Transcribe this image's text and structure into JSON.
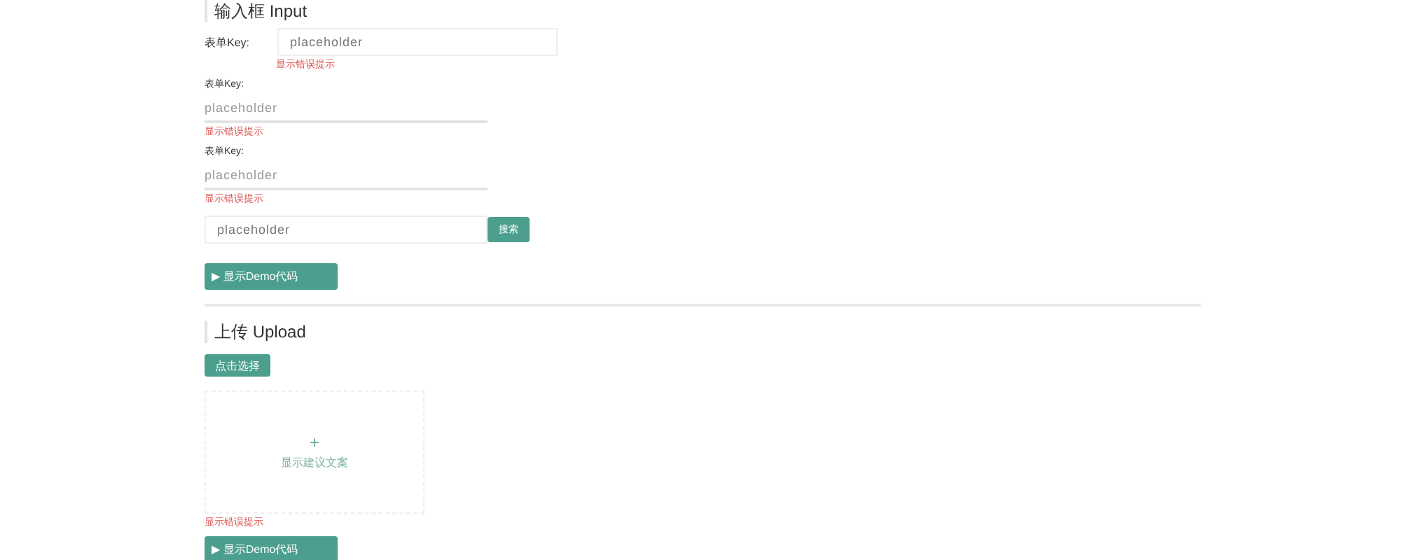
{
  "input_section": {
    "title": "输入框 Input",
    "inline_field": {
      "label": "表单Key:",
      "placeholder": "placeholder",
      "error": "显示错误提示"
    },
    "stacked_fields": [
      {
        "label": "表单Key:",
        "placeholder": "placeholder",
        "error": "显示错误提示"
      },
      {
        "label": "表单Key:",
        "placeholder": "placeholder",
        "error": "显示错误提示"
      }
    ],
    "search": {
      "placeholder": "placeholder",
      "button": "搜索"
    },
    "demo_button": "▶ 显示Demo代码"
  },
  "upload_section": {
    "title": "上传 Upload",
    "select_button": "点击选择",
    "dropzone": {
      "icon": "+",
      "hint": "显示建议文案"
    },
    "error": "显示错误提示",
    "demo_button": "▶ 显示Demo代码"
  }
}
